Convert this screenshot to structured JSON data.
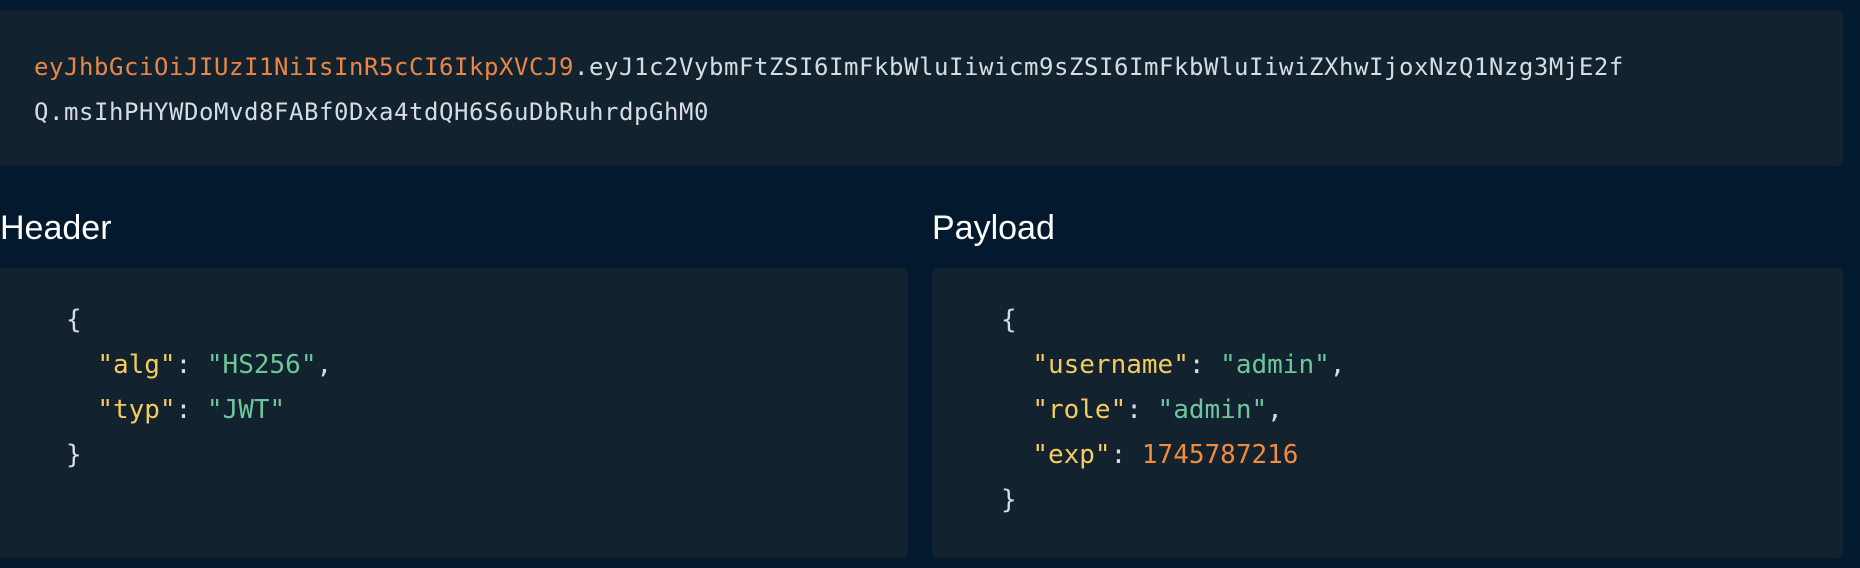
{
  "token": {
    "line1_header": "eyJhbGciOiJIUzI1NiIsInR5cCI6IkpXVCJ9",
    "line1_rest": ".eyJ1c2VybmFtZSI6ImFkbWluIiwicm9sZSI6ImFkbWluIiwiZXhwIjoxNzQ1Nzg3MjE2f",
    "line2": "Q.msIhPHYWDoMvd8FABf0Dxa4tdQH6S6uDbRuhrdpGhM0"
  },
  "header": {
    "title": "Header",
    "alg_key": "\"alg\"",
    "alg_value": "\"HS256\"",
    "typ_key": "\"typ\"",
    "typ_value": "\"JWT\""
  },
  "payload": {
    "title": "Payload",
    "username_key": "\"username\"",
    "username_value": "\"admin\"",
    "role_key": "\"role\"",
    "role_value": "\"admin\"",
    "exp_key": "\"exp\"",
    "exp_value": "1745787216"
  },
  "syntax": {
    "open_brace": "{",
    "close_brace": "}",
    "colon": ": ",
    "comma": ","
  },
  "colors": {
    "background": "#031a2e",
    "panel": "#13222f",
    "token_header": "#ea8646",
    "json_key": "#f5cb5c",
    "json_string": "#6cc79b",
    "json_number": "#f28b3c"
  }
}
